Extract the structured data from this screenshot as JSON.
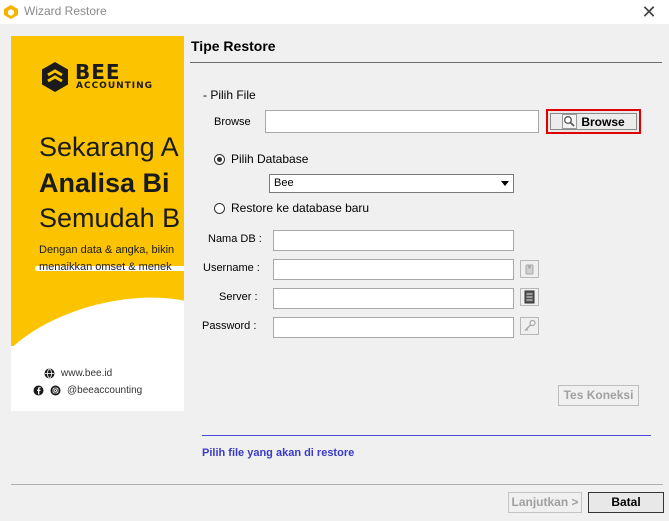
{
  "window": {
    "title": "Wizard Restore",
    "close_label": "✕"
  },
  "banner": {
    "brand_line1": "BEE",
    "brand_line2": "ACCOUNTING",
    "headline1": "Sekarang A",
    "headline2": "Analisa Bi",
    "headline3": "Semudah B",
    "sub1": "Dengan data & angka, bikin",
    "sub2": "menaikkan omset & menek",
    "website": "www.bee.id",
    "social": "@beeaccounting"
  },
  "section_title": "Tipe Restore",
  "file": {
    "group_label": "- Pilih File",
    "browse_label": "Browse",
    "path_value": "",
    "browse_button": "Browse"
  },
  "database": {
    "option_existing": "Pilih Database",
    "option_existing_checked": true,
    "selected_db": "Bee",
    "option_new": "Restore ke database baru",
    "option_new_checked": false
  },
  "form": {
    "nama_db_label": "Nama DB :",
    "username_label": "Username :",
    "server_label": "Server :",
    "password_label": "Password :",
    "nama_db_value": "",
    "username_value": "",
    "server_value": "",
    "password_value": ""
  },
  "test_button": "Tes Koneksi",
  "status_text": "Pilih file yang akan di restore",
  "footer": {
    "next_button": "Lanjutkan >",
    "cancel_button": "Batal"
  }
}
